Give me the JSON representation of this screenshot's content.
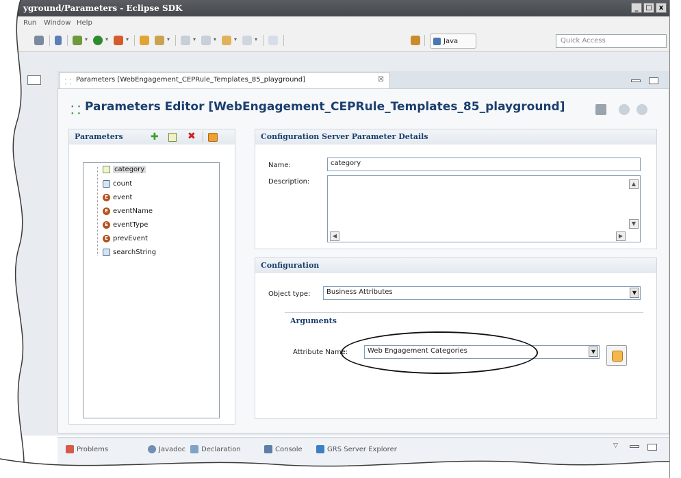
{
  "window": {
    "title": "yground/Parameters - Eclipse SDK",
    "controls": [
      "_",
      "□",
      "x"
    ]
  },
  "menu": {
    "items": [
      "Run",
      "Window",
      "Help"
    ]
  },
  "toolbar": {
    "java_perspective": "Java",
    "quick_access_placeholder": "Quick Access"
  },
  "editor": {
    "tab_label": "Parameters [WebEngagement_CEPRule_Templates_85_playground]",
    "tab_close": "☒",
    "title": "Parameters Editor [WebEngagement_CEPRule_Templates_85_playground]"
  },
  "parameters": {
    "section_title": "Parameters",
    "items": [
      {
        "label": "category",
        "icon": "doc"
      },
      {
        "label": "count",
        "icon": "db"
      },
      {
        "label": "event",
        "icon": "e"
      },
      {
        "label": "eventName",
        "icon": "e"
      },
      {
        "label": "eventType",
        "icon": "e"
      },
      {
        "label": "prevEvent",
        "icon": "e"
      },
      {
        "label": "searchString",
        "icon": "db"
      }
    ],
    "selected": "category"
  },
  "details": {
    "section_title": "Configuration Server Parameter Details",
    "name_label": "Name:",
    "name_value": "category",
    "description_label": "Description:",
    "description_value": ""
  },
  "configuration": {
    "section_title": "Configuration",
    "object_type_label": "Object type:",
    "object_type_value": "Business Attributes",
    "arguments_title": "Arguments",
    "attribute_name_label": "Attribute Name:",
    "attribute_name_value": "Web Engagement Categories"
  },
  "bottom_tabs": [
    "Problems",
    "Javadoc",
    "Declaration",
    "Console",
    "GRS Server Explorer"
  ],
  "colors": {
    "accent": "#1b3f6e",
    "titlebar": "#4f5256",
    "annotation": "#111111"
  }
}
